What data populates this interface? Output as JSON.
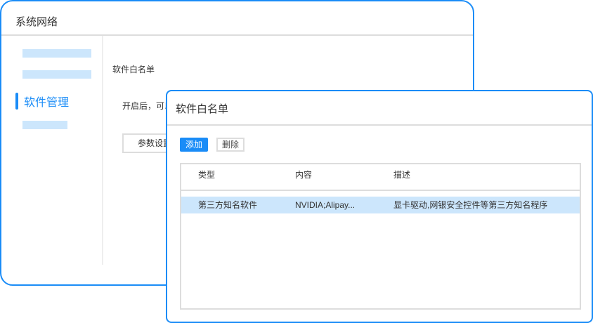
{
  "back_window": {
    "title": "系统网络",
    "sidebar": {
      "active_item": "软件管理"
    },
    "section_title": "软件白名单",
    "hint": "开启后，可以",
    "param_button": "参数设置"
  },
  "dialog": {
    "title": "软件白名单",
    "add_label": "添加",
    "delete_label": "删除",
    "columns": [
      "类型",
      "内容",
      "描述"
    ],
    "rows": [
      {
        "type": "第三方知名软件",
        "content": "NVIDIA;Alipay...",
        "description": "显卡驱动,网银安全控件等第三方知名程序",
        "selected": true
      }
    ]
  },
  "colors": {
    "accent": "#1a8cf7",
    "selection": "#cce6fc",
    "border": "#dddddd"
  }
}
